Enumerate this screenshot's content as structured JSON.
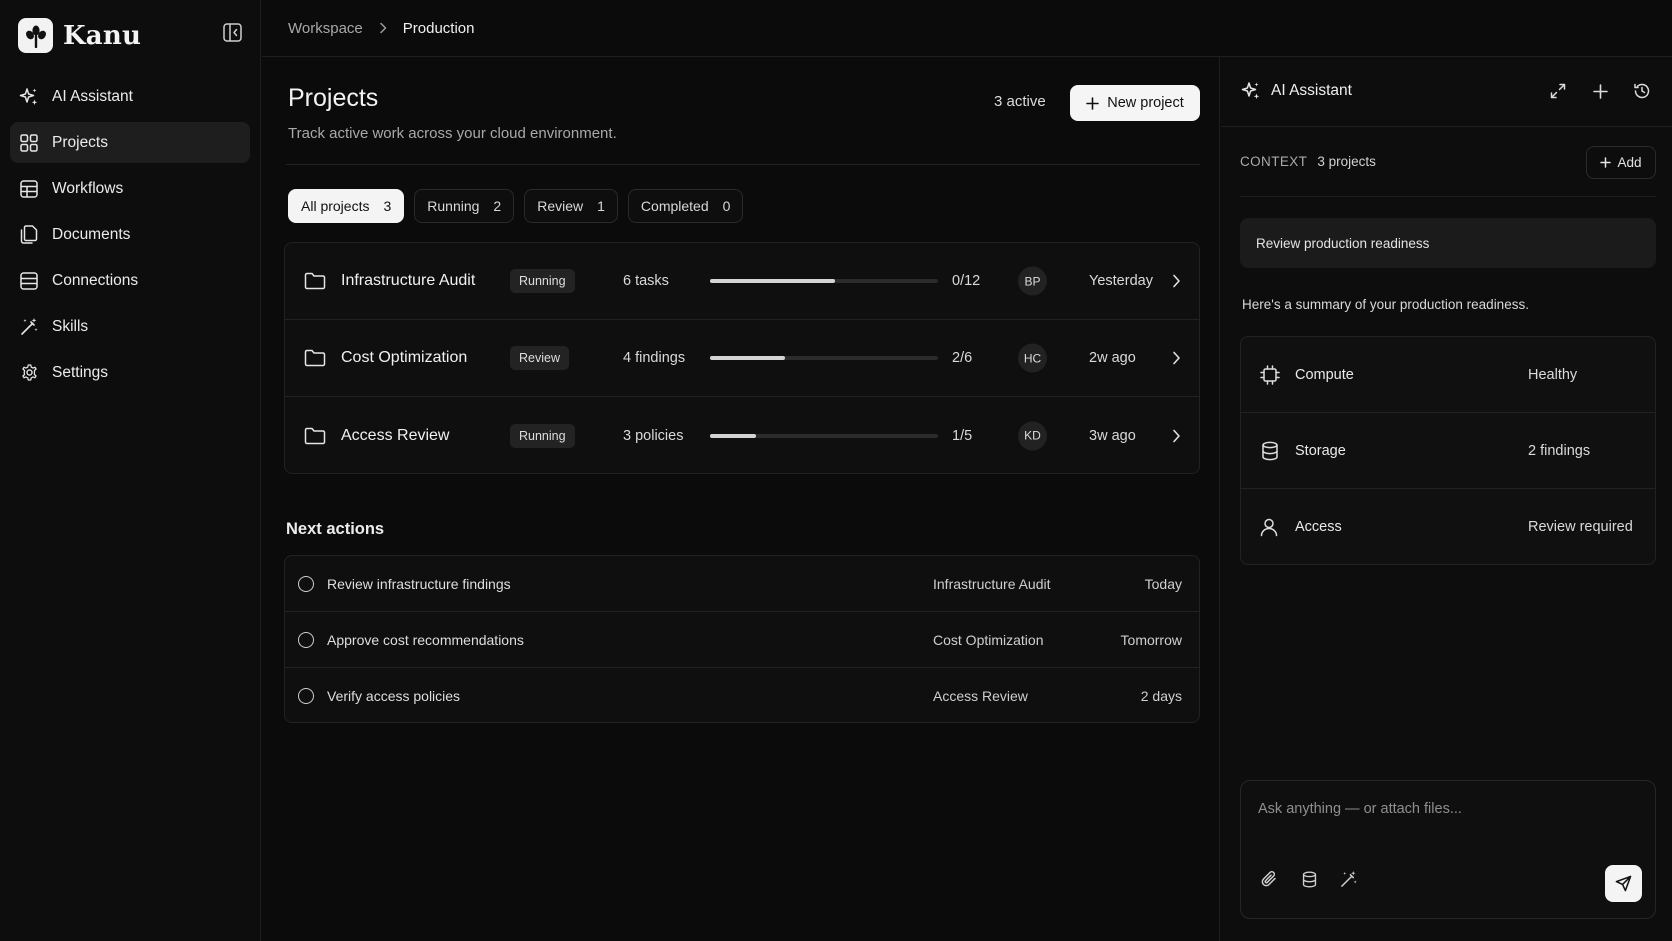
{
  "app": {
    "name": "Kanu"
  },
  "sidebar": {
    "items": [
      {
        "label": "AI Assistant",
        "icon": "sparkle-icon",
        "active": false
      },
      {
        "label": "Projects",
        "icon": "grid-icon",
        "active": true
      },
      {
        "label": "Workflows",
        "icon": "table-icon",
        "active": false
      },
      {
        "label": "Documents",
        "icon": "documents-icon",
        "active": false
      },
      {
        "label": "Connections",
        "icon": "database-icon",
        "active": false
      },
      {
        "label": "Skills",
        "icon": "magic-wand-icon",
        "active": false
      },
      {
        "label": "Settings",
        "icon": "gear-icon",
        "active": false
      }
    ]
  },
  "breadcrumb": {
    "root": "Workspace",
    "current": "Production"
  },
  "page": {
    "title": "Projects",
    "subtitle": "Track active work across your cloud environment.",
    "active_count": "3 active",
    "new_button": "New project"
  },
  "tabs": [
    {
      "label": "All projects",
      "count": "3",
      "active": true
    },
    {
      "label": "Running",
      "count": "2",
      "active": false
    },
    {
      "label": "Review",
      "count": "1",
      "active": false
    },
    {
      "label": "Completed",
      "count": "0",
      "active": false
    }
  ],
  "projects": [
    {
      "name": "Infrastructure Audit",
      "status": "Running",
      "items": "6 tasks",
      "progress": 0.55,
      "fraction": "0/12",
      "owner": "BP",
      "updated": "Yesterday"
    },
    {
      "name": "Cost Optimization",
      "status": "Review",
      "items": "4 findings",
      "progress": 0.33,
      "fraction": "2/6",
      "owner": "HC",
      "updated": "2w ago"
    },
    {
      "name": "Access Review",
      "status": "Running",
      "items": "3 policies",
      "progress": 0.2,
      "fraction": "1/5",
      "owner": "KD",
      "updated": "3w ago"
    }
  ],
  "next_actions": {
    "title": "Next actions",
    "items": [
      {
        "label": "Review infrastructure findings",
        "project": "Infrastructure Audit",
        "due": "Today"
      },
      {
        "label": "Approve cost recommendations",
        "project": "Cost Optimization",
        "due": "Tomorrow"
      },
      {
        "label": "Verify access policies",
        "project": "Access Review",
        "due": "2 days"
      }
    ]
  },
  "assistant": {
    "title": "AI Assistant",
    "context_label": "CONTEXT",
    "context_value": "3 projects",
    "add_label": "Add",
    "user_message": "Review production readiness",
    "reply": "Here's a summary of your production readiness.",
    "summary": [
      {
        "label": "Compute",
        "value": "Healthy",
        "icon": "cpu-icon"
      },
      {
        "label": "Storage",
        "value": "2 findings",
        "icon": "database-icon"
      },
      {
        "label": "Access",
        "value": "Review required",
        "icon": "user-icon"
      }
    ],
    "input_placeholder": "Ask anything — or attach files..."
  }
}
